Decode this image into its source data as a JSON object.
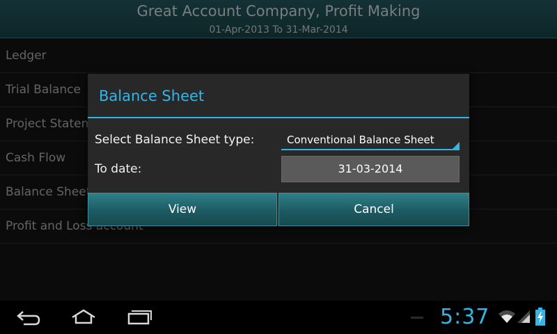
{
  "header": {
    "title": "Great Account Company, Profit Making",
    "subtitle": "01-Apr-2013 To 31-Mar-2014"
  },
  "menu": {
    "items": [
      {
        "label": "Ledger"
      },
      {
        "label": "Trial Balance"
      },
      {
        "label": "Project Statement"
      },
      {
        "label": "Cash Flow"
      },
      {
        "label": "Balance Sheet"
      },
      {
        "label": "Profit and Loss account"
      }
    ]
  },
  "dialog": {
    "title": "Balance Sheet",
    "type_label": "Select Balance Sheet type:",
    "type_value": "Conventional Balance Sheet",
    "date_label": "To date:",
    "date_value": "31-03-2014",
    "view_label": "View",
    "cancel_label": "Cancel"
  },
  "status": {
    "time": "5:37"
  },
  "colors": {
    "accent": "#33b5e5",
    "header_bg": "#1b4347",
    "button_bg": "#256a73"
  },
  "icons": [
    "back-icon",
    "home-icon",
    "recent-apps-icon",
    "wifi-icon",
    "signal-icon",
    "battery-charging-icon"
  ]
}
